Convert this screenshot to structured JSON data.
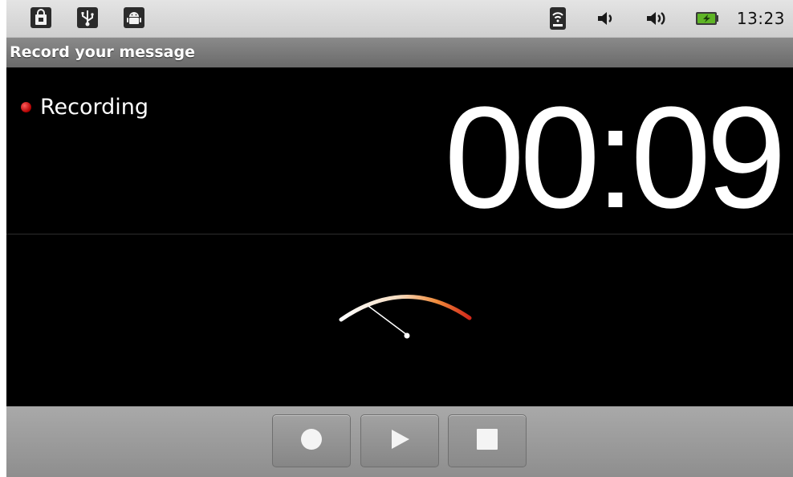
{
  "status_bar": {
    "left_icons": [
      "shopping-bag-icon",
      "usb-icon",
      "android-icon"
    ],
    "right_icons": [
      "wifi-icon",
      "volume-icon",
      "volume-loud-icon",
      "battery-charging-icon"
    ],
    "time": "13:23",
    "battery_color": "#5fb526"
  },
  "title_bar": {
    "title": "Record your message"
  },
  "recorder": {
    "state_label": "Recording",
    "elapsed": "00:09",
    "indicator_color": "#d11010"
  },
  "vu_meter": {
    "level_fraction": 0.12
  },
  "controls": [
    {
      "name": "record",
      "icon": "record-icon",
      "enabled": true
    },
    {
      "name": "play",
      "icon": "play-icon",
      "enabled": true
    },
    {
      "name": "stop",
      "icon": "stop-icon",
      "enabled": true
    }
  ]
}
